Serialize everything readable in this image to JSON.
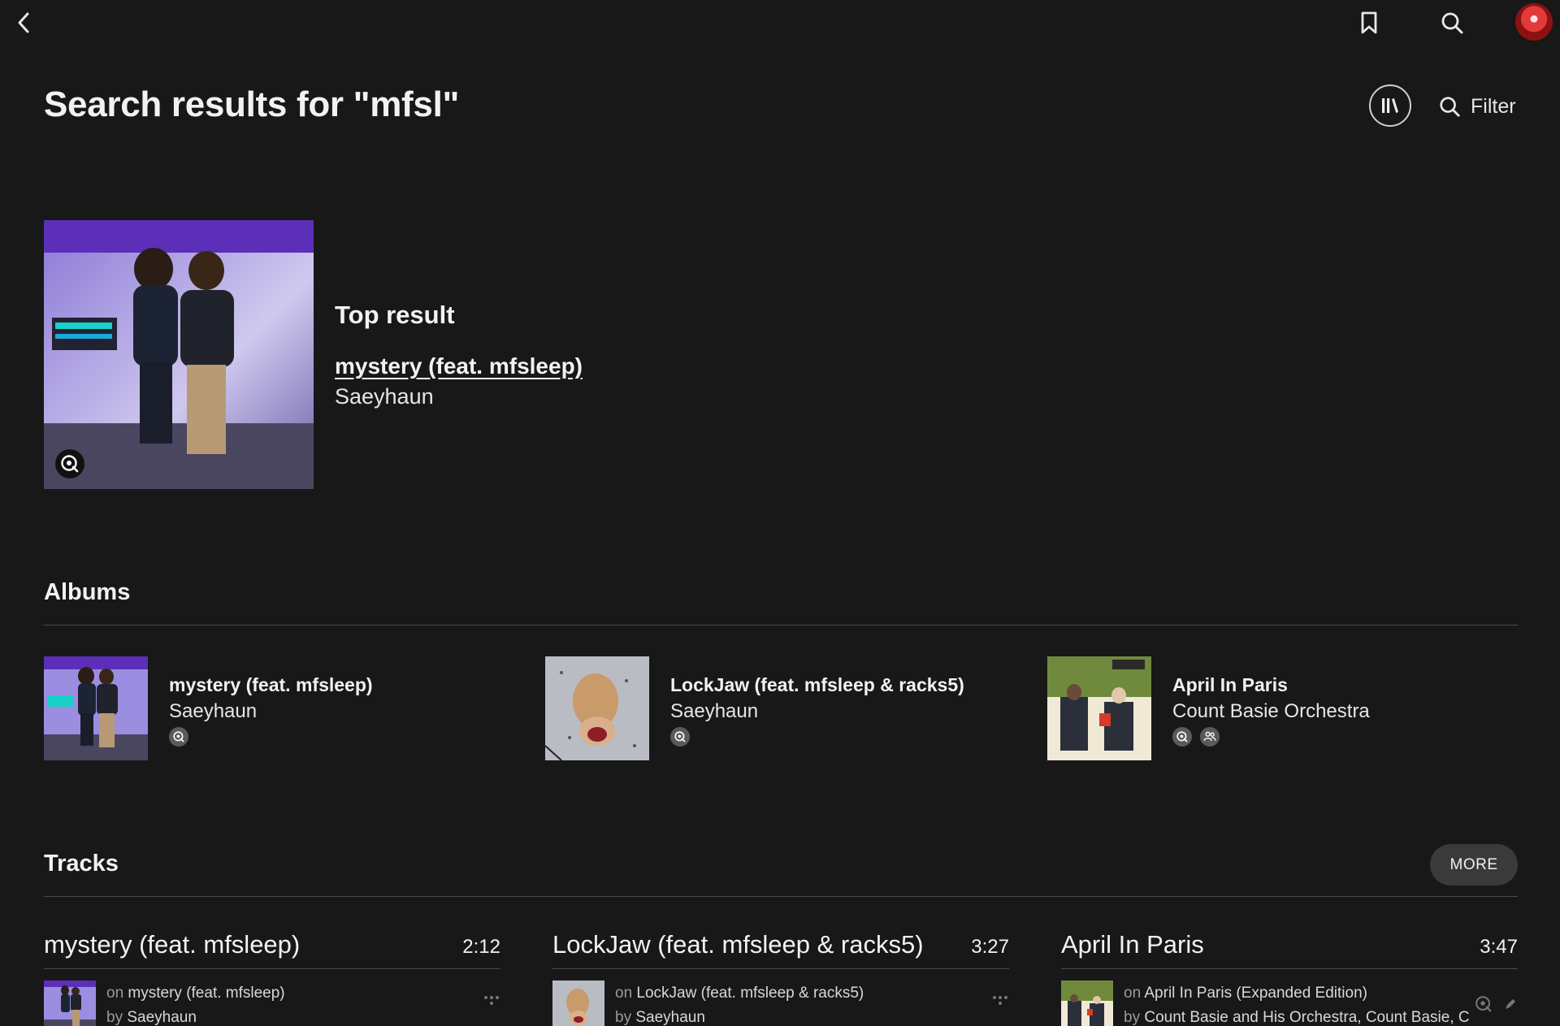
{
  "header": {
    "back_icon": "chevron-left-icon",
    "bookmark_icon": "bookmark-icon",
    "search_icon": "search-icon",
    "avatar_color": "#e23a3a"
  },
  "page": {
    "title": "Search results for \"mfsl\"",
    "library_icon": "library-icon",
    "filter_label": "Filter"
  },
  "top_result": {
    "label": "Top result",
    "title": "mystery (feat. mfsleep)",
    "artist": "Saeyhaun",
    "badge_icon": "hires-quality-icon"
  },
  "albums": {
    "heading": "Albums",
    "items": [
      {
        "title": "mystery (feat. mfsleep)",
        "artist": "Saeyhaun",
        "badges": [
          "hires-quality-icon"
        ]
      },
      {
        "title": "LockJaw (feat. mfsleep & racks5)",
        "artist": "Saeyhaun",
        "badges": [
          "hires-quality-icon"
        ]
      },
      {
        "title": "April In Paris",
        "artist": "Count Basie Orchestra",
        "badges": [
          "hires-quality-icon",
          "users-icon"
        ]
      }
    ]
  },
  "tracks": {
    "heading": "Tracks",
    "more_label": "MORE",
    "items": [
      {
        "title": "mystery (feat. mfsleep)",
        "duration": "2:12",
        "on_prefix": "on",
        "album": "mystery (feat. mfsleep)",
        "by_prefix": "by",
        "artists": "Saeyhaun"
      },
      {
        "title": "LockJaw (feat. mfsleep & racks5)",
        "duration": "3:27",
        "on_prefix": "on",
        "album": "LockJaw (feat. mfsleep & racks5)",
        "by_prefix": "by",
        "artists": "Saeyhaun"
      },
      {
        "title": "April In Paris",
        "duration": "3:47",
        "on_prefix": "on",
        "album": "April In Paris (Expanded Edition)",
        "by_prefix": "by",
        "artists": "Count Basie and His Orchestra, Count Basie, C"
      }
    ]
  },
  "colors": {
    "background": "#181818",
    "text": "#f2f2f2",
    "divider": "#4a4a4a",
    "more_button": "#3a3a3a"
  }
}
